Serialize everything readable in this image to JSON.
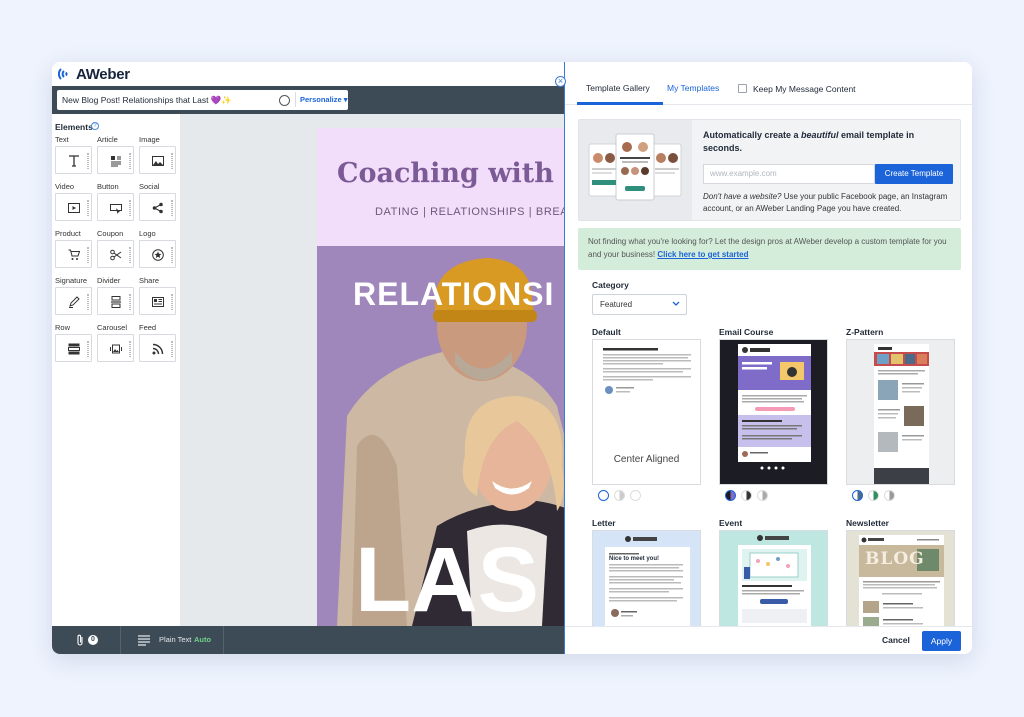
{
  "app": {
    "logo_text": "AWeber"
  },
  "subject": {
    "value": "New Blog Post! Relationships that Last 💜✨",
    "personalize_label": "Personalize"
  },
  "elements": {
    "title": "Elements",
    "items": [
      {
        "label": "Text",
        "icon": "text-icon"
      },
      {
        "label": "Article",
        "icon": "article-icon"
      },
      {
        "label": "Image",
        "icon": "image-icon"
      },
      {
        "label": "Video",
        "icon": "video-icon"
      },
      {
        "label": "Button",
        "icon": "button-icon"
      },
      {
        "label": "Social",
        "icon": "share-network-icon"
      },
      {
        "label": "Product",
        "icon": "cart-icon"
      },
      {
        "label": "Coupon",
        "icon": "scissors-icon"
      },
      {
        "label": "Logo",
        "icon": "logo-icon"
      },
      {
        "label": "Signature",
        "icon": "pen-icon"
      },
      {
        "label": "Divider",
        "icon": "divider-icon"
      },
      {
        "label": "Share",
        "icon": "newspaper-icon"
      },
      {
        "label": "Row",
        "icon": "row-icon"
      },
      {
        "label": "Carousel",
        "icon": "carousel-icon"
      },
      {
        "label": "Feed",
        "icon": "rss-icon"
      }
    ]
  },
  "email": {
    "title": "Coaching with S",
    "subtitle": "DATING | RELATIONSHIPS | BREA",
    "hero_text": "RELATIONSI",
    "big_text": "LAS"
  },
  "bottom_bar": {
    "attachments": "0",
    "plaintext_label": "Plain Text",
    "plaintext_mode": "Auto"
  },
  "panel": {
    "tabs": {
      "gallery": "Template Gallery",
      "my_templates": "My Templates"
    },
    "keep_content_label": "Keep My Message Content",
    "auto_card": {
      "title_pre": "Automatically create a ",
      "title_em": "beautiful",
      "title_post": " email template in seconds.",
      "url_placeholder": "www.example.com",
      "create_label": "Create Template",
      "note_em": "Don't have a website?",
      "note_rest": " Use your public Facebook page, an Instagram account, or an AWeber Landing Page you have created."
    },
    "promo": {
      "text": "Not finding what you're looking for? Let the design pros at AWeber develop a custom template for you and your business! ",
      "link": "Click here to get started"
    },
    "category": {
      "label": "Category",
      "selected": "Featured"
    },
    "templates": [
      {
        "name": "Default",
        "caption": "Center Aligned"
      },
      {
        "name": "Email Course"
      },
      {
        "name": "Z-Pattern"
      },
      {
        "name": "Letter",
        "thumb_heading": "Nice to meet you!"
      },
      {
        "name": "Event"
      },
      {
        "name": "Newsletter",
        "thumb_heading": "BLOG"
      }
    ],
    "footer": {
      "cancel": "Cancel",
      "apply": "Apply"
    }
  },
  "colors": {
    "accent": "#1b63d8",
    "dark_bar": "#3d4b57",
    "promo_bg": "#d4edda",
    "email_head": "#f2ddfb",
    "email_title": "#7b5a95"
  }
}
